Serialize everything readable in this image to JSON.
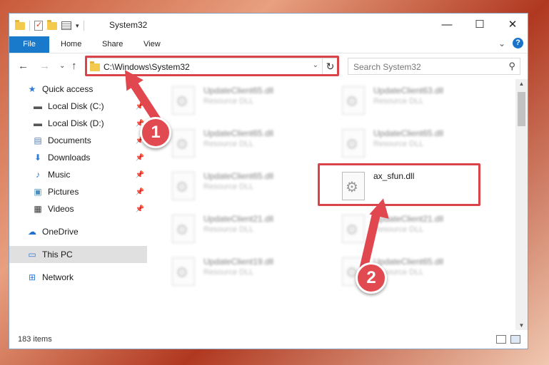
{
  "window": {
    "title": "System32",
    "minimize": "—",
    "maximize": "☐",
    "close": "✕"
  },
  "ribbon": {
    "tabs": [
      "File",
      "Home",
      "Share",
      "View"
    ],
    "collapse": "⌄",
    "help": "?"
  },
  "address": {
    "path": "C:\\Windows\\System32",
    "dropdown": "⌄",
    "refresh": "↻",
    "back": "←",
    "forward": "→",
    "recent": "⌄",
    "up": "↑"
  },
  "search": {
    "placeholder": "Search System32",
    "icon": "search-icon"
  },
  "nav": {
    "items": [
      {
        "label": "Quick access",
        "icon": "star-icon",
        "glyph": "★",
        "color": "#2e7bd6"
      },
      {
        "label": "Local Disk (C:)",
        "icon": "drive-icon",
        "glyph": "▬",
        "color": "#555555",
        "pinned": true
      },
      {
        "label": "Local Disk (D:)",
        "icon": "drive-icon",
        "glyph": "▬",
        "color": "#555555",
        "pinned": true
      },
      {
        "label": "Documents",
        "icon": "documents-icon",
        "glyph": "▤",
        "color": "#5a7fb0",
        "pinned": true
      },
      {
        "label": "Downloads",
        "icon": "downloads-icon",
        "glyph": "⬇",
        "color": "#2e7bd6",
        "pinned": true
      },
      {
        "label": "Music",
        "icon": "music-icon",
        "glyph": "♪",
        "color": "#2e7bd6",
        "pinned": true
      },
      {
        "label": "Pictures",
        "icon": "pictures-icon",
        "glyph": "▣",
        "color": "#4a8fbf",
        "pinned": true
      },
      {
        "label": "Videos",
        "icon": "videos-icon",
        "glyph": "▦",
        "color": "#333333",
        "pinned": true
      },
      {
        "label": "OneDrive",
        "icon": "onedrive-icon",
        "glyph": "☁",
        "color": "#1f6fd1"
      },
      {
        "label": "This PC",
        "icon": "pc-icon",
        "glyph": "▭",
        "color": "#2e7bd6",
        "selected": true
      },
      {
        "label": "Network",
        "icon": "network-icon",
        "glyph": "⊞",
        "color": "#2e7bd6"
      }
    ],
    "pin_glyph": "📌"
  },
  "files": [
    {
      "name": "UpdateClient65.dll",
      "type": "Resource DLL",
      "blurred": true
    },
    {
      "name": "UpdateClient63.dll",
      "type": "Resource DLL",
      "blurred": true
    },
    {
      "name": "UpdateClient65.dll",
      "type": "Resource DLL",
      "blurred": true
    },
    {
      "name": "UpdateClient65.dll",
      "type": "Resource DLL",
      "blurred": true
    },
    {
      "name": "UpdateClient65.dll",
      "type": "Resource DLL",
      "blurred": true
    },
    {
      "name": "ax_sfun.dll",
      "type": "",
      "blurred": false
    },
    {
      "name": "UpdateClient21.dll",
      "type": "Resource DLL",
      "blurred": true
    },
    {
      "name": "UpdateClient21.dll",
      "type": "Resource DLL",
      "blurred": true
    },
    {
      "name": "UpdateClient19.dll",
      "type": "Resource DLL",
      "blurred": true
    },
    {
      "name": "UpdateClient65.dll",
      "type": "Resource DLL",
      "blurred": true
    }
  ],
  "status": {
    "count": "183 items"
  },
  "callouts": [
    {
      "number": "1"
    },
    {
      "number": "2"
    }
  ],
  "colors": {
    "accent": "#1979ca",
    "highlight": "#d9434a",
    "callout": "#e04a50"
  }
}
